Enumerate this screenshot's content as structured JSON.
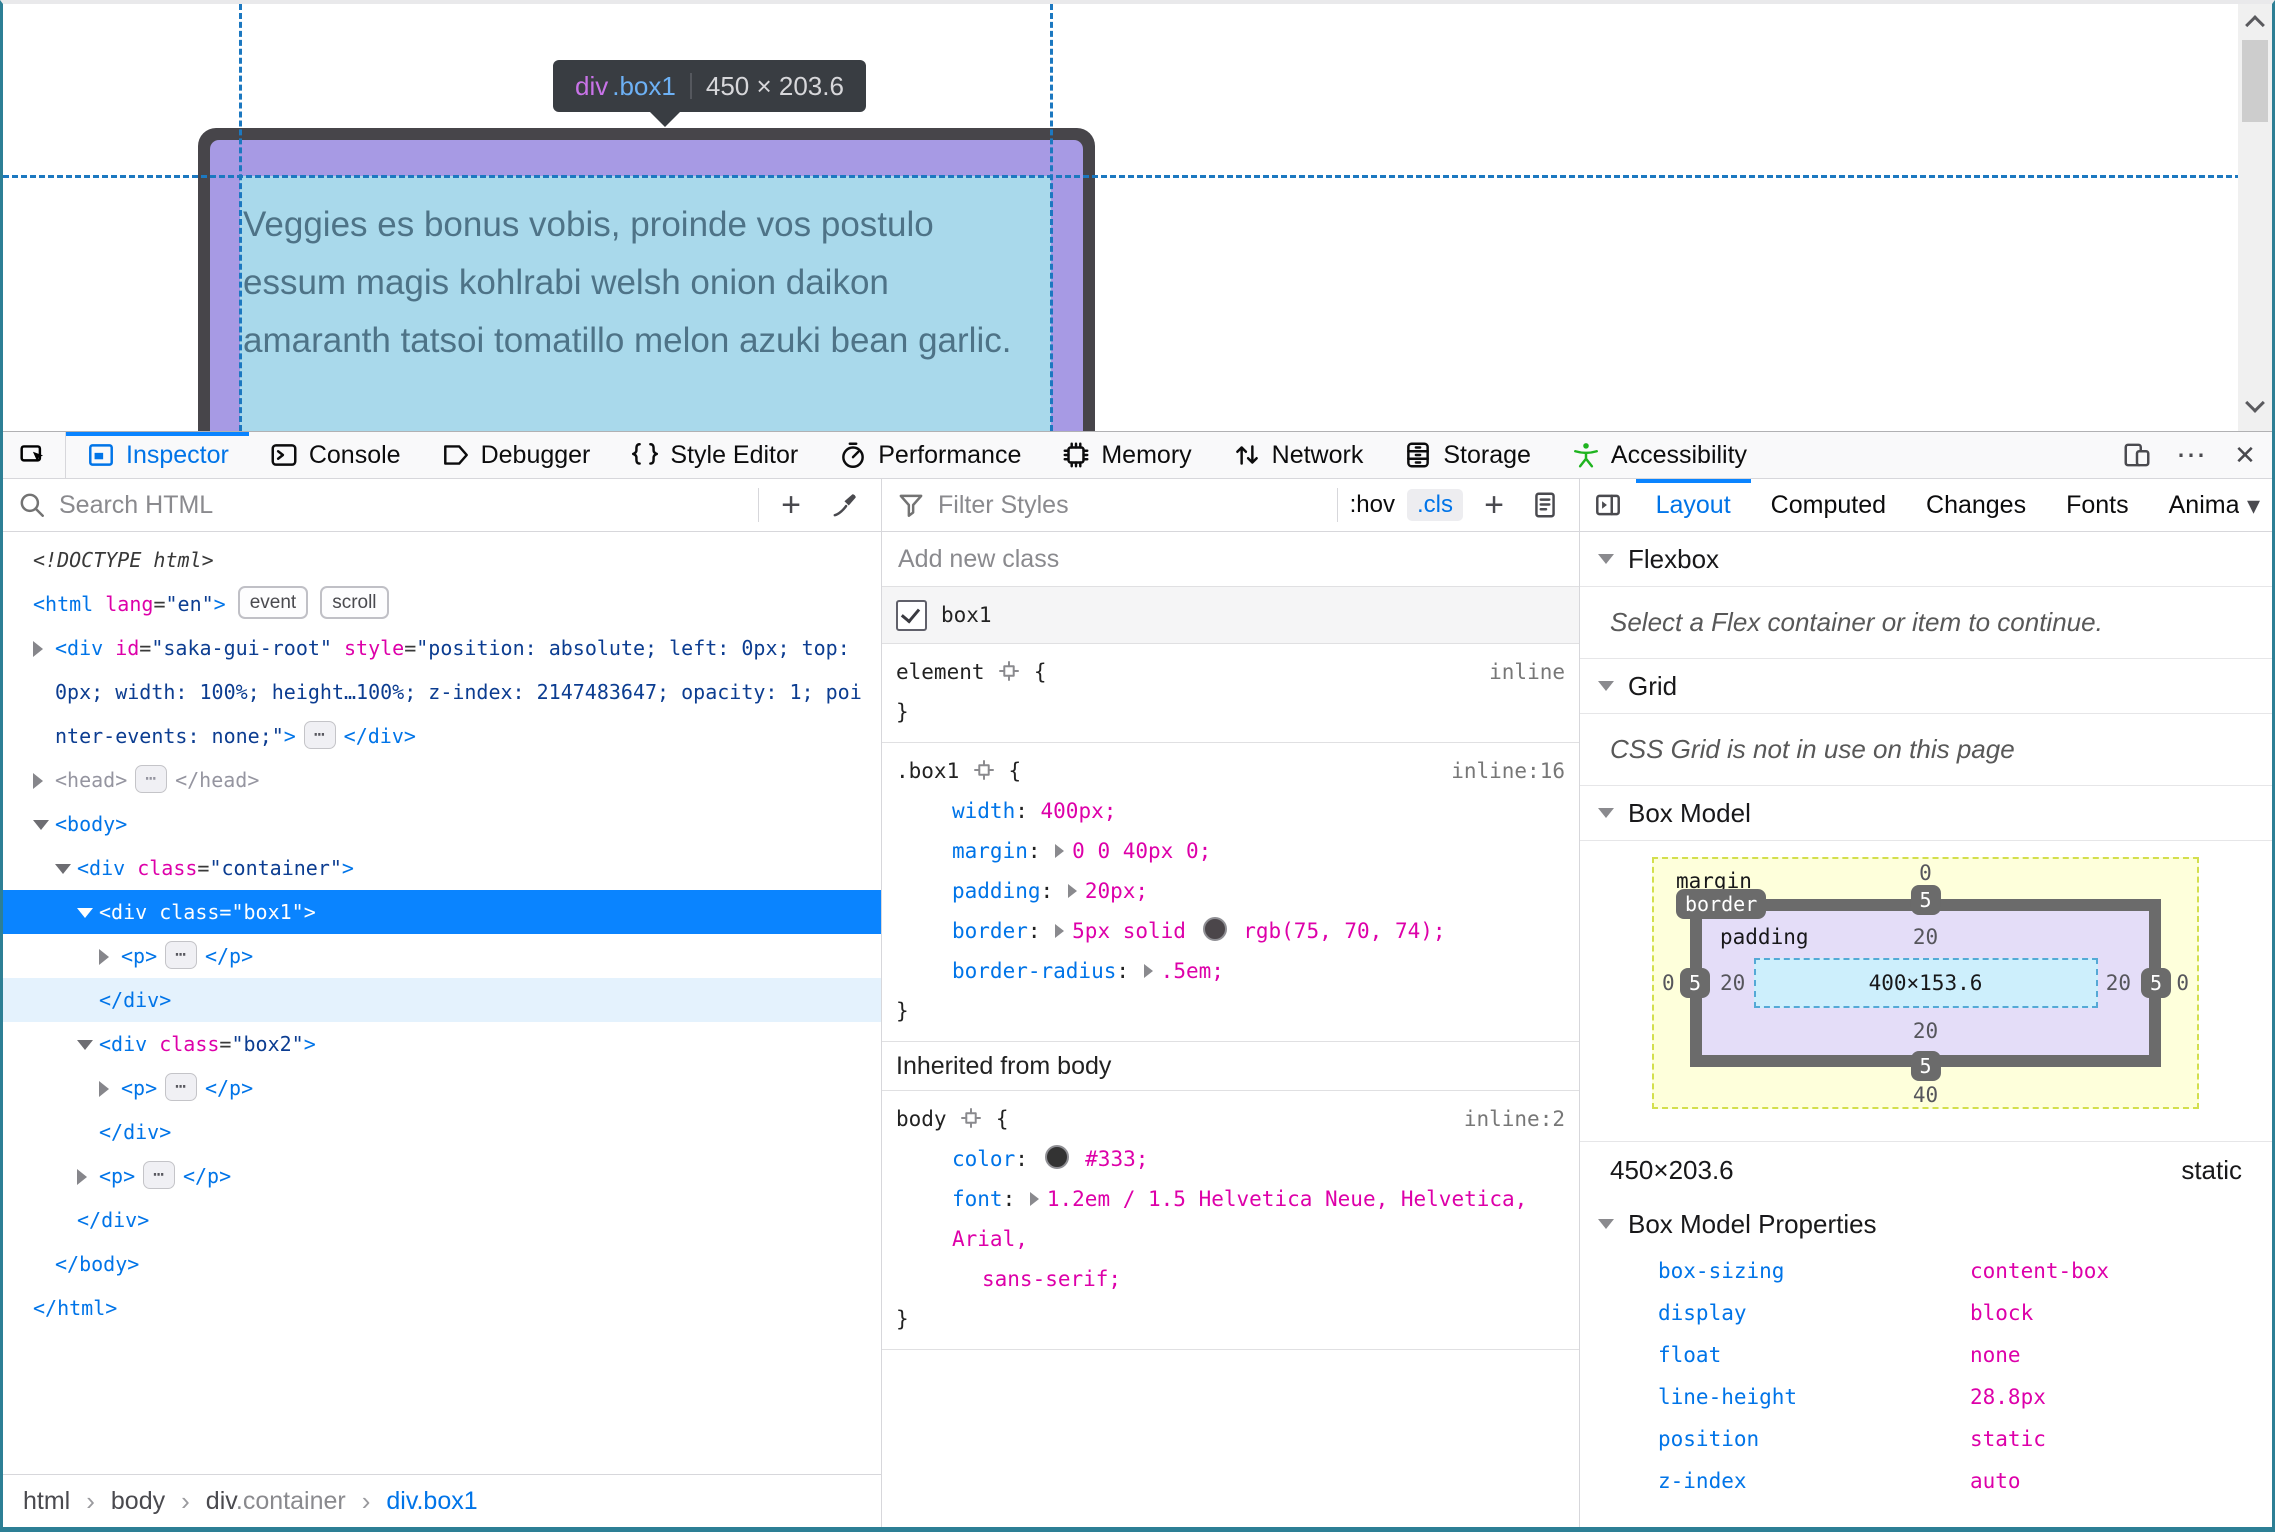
{
  "colors": {
    "accent": "#0074e8",
    "selection": "#0a84ff",
    "guide": "#1c78c0",
    "highlight_padding": "#a79ae4",
    "highlight_content": "#a9d9eb",
    "accessibility_green": "#1fb41f"
  },
  "page": {
    "tooltip": {
      "tag": "div",
      "class": ".box1",
      "dims": "450 × 203.6"
    },
    "text": "Veggies es bonus vobis, proinde vos postulo essum magis kohlrabi welsh onion daikon amaranth tatsoi tomatillo melon azuki bean garlic."
  },
  "toolbar": {
    "tabs": [
      {
        "label": "Inspector",
        "icon": "inspector",
        "active": true
      },
      {
        "label": "Console",
        "icon": "console"
      },
      {
        "label": "Debugger",
        "icon": "debugger"
      },
      {
        "label": "Style Editor",
        "icon": "styleeditor"
      },
      {
        "label": "Performance",
        "icon": "performance"
      },
      {
        "label": "Memory",
        "icon": "memory"
      },
      {
        "label": "Network",
        "icon": "network"
      },
      {
        "label": "Storage",
        "icon": "storage"
      },
      {
        "label": "Accessibility",
        "icon": "accessibility",
        "color": "#1fb41f"
      }
    ],
    "more": "⋯",
    "close": "✕"
  },
  "markup": {
    "search_placeholder": "Search HTML",
    "tree": [
      {
        "lvl": 0,
        "tokens": [
          {
            "t": "doctype",
            "x": "<!DOCTYPE html>"
          }
        ]
      },
      {
        "lvl": 0,
        "tokens": [
          {
            "t": "tag",
            "x": "<html"
          },
          {
            "t": "attr",
            "x": " lang"
          },
          {
            "t": "plain",
            "x": "="
          },
          {
            "t": "str",
            "x": "\"en\""
          },
          {
            "t": "tag",
            "x": ">"
          },
          {
            "t": "badge",
            "x": "event"
          },
          {
            "t": "badge",
            "x": "scroll"
          }
        ]
      },
      {
        "lvl": 1,
        "tw": "closed",
        "tokens": [
          {
            "t": "tag",
            "x": "<div"
          },
          {
            "t": "attr",
            "x": " id"
          },
          {
            "t": "plain",
            "x": "="
          },
          {
            "t": "str",
            "x": "\"saka-gui-root\""
          },
          {
            "t": "attr",
            "x": " style"
          },
          {
            "t": "plain",
            "x": "="
          },
          {
            "t": "str",
            "x": "\"position: absolute; left: 0px; top: 0px; width: 100%; height…100%; z-index: 2147483647; opacity: 1; pointer-events: none;\""
          },
          {
            "t": "tag",
            "x": ">"
          },
          {
            "t": "ellipsis",
            "x": "⋯"
          },
          {
            "t": "tag",
            "x": "</div>"
          }
        ]
      },
      {
        "lvl": 1,
        "tw": "closed",
        "dim": true,
        "tokens": [
          {
            "t": "tag",
            "x": "<head>"
          },
          {
            "t": "ellipsis",
            "x": "⋯"
          },
          {
            "t": "tag",
            "x": "</head>"
          }
        ]
      },
      {
        "lvl": 1,
        "tw": "open",
        "tokens": [
          {
            "t": "tag",
            "x": "<body>"
          }
        ]
      },
      {
        "lvl": 2,
        "tw": "open",
        "tokens": [
          {
            "t": "tag",
            "x": "<div"
          },
          {
            "t": "attr",
            "x": " class"
          },
          {
            "t": "plain",
            "x": "="
          },
          {
            "t": "str",
            "x": "\"container\""
          },
          {
            "t": "tag",
            "x": ">"
          }
        ]
      },
      {
        "lvl": 3,
        "tw": "open",
        "sel": true,
        "tokens": [
          {
            "t": "tag",
            "x": "<div"
          },
          {
            "t": "attr",
            "x": " class"
          },
          {
            "t": "plain",
            "x": "="
          },
          {
            "t": "str",
            "x": "\"box1\""
          },
          {
            "t": "tag",
            "x": ">"
          }
        ]
      },
      {
        "lvl": 4,
        "tw": "closed",
        "tokens": [
          {
            "t": "tag",
            "x": "<p>"
          },
          {
            "t": "ellipsis",
            "x": "⋯"
          },
          {
            "t": "tag",
            "x": "</p>"
          }
        ]
      },
      {
        "lvl": 3,
        "tail": true,
        "tokens": [
          {
            "t": "tag",
            "x": "</div>"
          }
        ]
      },
      {
        "lvl": 3,
        "tw": "open",
        "tokens": [
          {
            "t": "tag",
            "x": "<div"
          },
          {
            "t": "attr",
            "x": " class"
          },
          {
            "t": "plain",
            "x": "="
          },
          {
            "t": "str",
            "x": "\"box2\""
          },
          {
            "t": "tag",
            "x": ">"
          }
        ]
      },
      {
        "lvl": 4,
        "tw": "closed",
        "tokens": [
          {
            "t": "tag",
            "x": "<p>"
          },
          {
            "t": "ellipsis",
            "x": "⋯"
          },
          {
            "t": "tag",
            "x": "</p>"
          }
        ]
      },
      {
        "lvl": 3,
        "tokens": [
          {
            "t": "tag",
            "x": "</div>"
          }
        ]
      },
      {
        "lvl": 3,
        "tw": "closed",
        "tokens": [
          {
            "t": "tag",
            "x": "<p>"
          },
          {
            "t": "ellipsis",
            "x": "⋯"
          },
          {
            "t": "tag",
            "x": "</p>"
          }
        ]
      },
      {
        "lvl": 2,
        "tokens": [
          {
            "t": "tag",
            "x": "</div>"
          }
        ]
      },
      {
        "lvl": 1,
        "tokens": [
          {
            "t": "tag",
            "x": "</body>"
          }
        ]
      },
      {
        "lvl": 0,
        "tokens": [
          {
            "t": "tag",
            "x": "</html>"
          }
        ]
      }
    ],
    "breadcrumbs": [
      {
        "text": "html"
      },
      {
        "text": "body"
      },
      {
        "text": "div",
        "suffix": ".container"
      },
      {
        "text": "div.box1",
        "active": true
      }
    ]
  },
  "rules": {
    "filter_placeholder": "Filter Styles",
    "hov": ":hov",
    "cls": ".cls",
    "add_class_placeholder": "Add new class",
    "class_toggle": {
      "label": "box1",
      "checked": true
    },
    "sections": [
      {
        "type": "rule",
        "selector": "element",
        "link": "inline",
        "decls": []
      },
      {
        "type": "rule",
        "selector": ".box1",
        "link": "inline:16",
        "decls": [
          {
            "name": "width",
            "value": [
              {
                "x": "400px;"
              }
            ]
          },
          {
            "name": "margin",
            "expand": true,
            "value": [
              {
                "x": "0 0 40px 0;"
              }
            ]
          },
          {
            "name": "padding",
            "expand": true,
            "value": [
              {
                "x": "20px;"
              }
            ]
          },
          {
            "name": "border",
            "expand": true,
            "value": [
              {
                "x": "5px solid "
              },
              {
                "swatch": "#4b464a"
              },
              {
                "x": " rgb(75, 70, 74);"
              }
            ]
          },
          {
            "name": "border-radius",
            "expand": true,
            "value": [
              {
                "x": ".5em;"
              }
            ]
          }
        ]
      },
      {
        "type": "header",
        "text": "Inherited from body"
      },
      {
        "type": "rule",
        "selector": "body",
        "link": "inline:2",
        "decls": [
          {
            "name": "color",
            "value": [
              {
                "swatch": "#333333"
              },
              {
                "x": " #333;"
              }
            ]
          },
          {
            "name": "font",
            "expand": true,
            "value": [
              {
                "x": "1.2em / 1.5 Helvetica Neue, Helvetica, Arial,"
              },
              {
                "br": true
              },
              {
                "x": "sans-serif;"
              }
            ]
          }
        ]
      }
    ]
  },
  "layout": {
    "tabs": [
      {
        "label": "Layout",
        "active": true
      },
      {
        "label": "Computed"
      },
      {
        "label": "Changes"
      },
      {
        "label": "Fonts"
      },
      {
        "label": "Animati"
      }
    ],
    "tabs_overflow": "▾",
    "flexbox": {
      "title": "Flexbox",
      "message": "Select a Flex container or item to continue."
    },
    "grid": {
      "title": "Grid",
      "message": "CSS Grid is not in use on this page"
    },
    "box_model": {
      "title": "Box Model",
      "margin_label": "margin",
      "border_label": "border",
      "padding_label": "padding",
      "margin": {
        "top": "0",
        "right": "0",
        "bottom": "40",
        "left": "0"
      },
      "border": {
        "top": "5",
        "right": "5",
        "bottom": "5",
        "left": "5"
      },
      "padding": {
        "top": "20",
        "right": "20",
        "bottom": "20",
        "left": "20"
      },
      "content": "400×153.6",
      "dims": "450×203.6",
      "position": "static"
    },
    "props": {
      "title": "Box Model Properties",
      "rows": [
        {
          "name": "box-sizing",
          "value": "content-box"
        },
        {
          "name": "display",
          "value": "block"
        },
        {
          "name": "float",
          "value": "none"
        },
        {
          "name": "line-height",
          "value": "28.8px"
        },
        {
          "name": "position",
          "value": "static"
        },
        {
          "name": "z-index",
          "value": "auto"
        }
      ]
    }
  }
}
